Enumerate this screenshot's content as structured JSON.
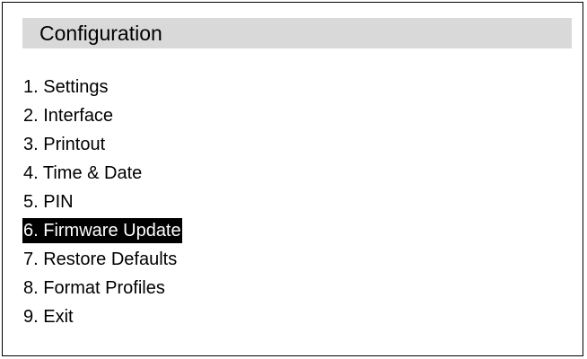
{
  "window": {
    "title": "Configuration"
  },
  "menu": {
    "selected_index": 5,
    "items": [
      {
        "label": "1. Settings"
      },
      {
        "label": "2. Interface"
      },
      {
        "label": "3. Printout"
      },
      {
        "label": "4. Time & Date"
      },
      {
        "label": "5. PIN"
      },
      {
        "label": "6. Firmware Update"
      },
      {
        "label": "7. Restore Defaults"
      },
      {
        "label": "8. Format Profiles"
      },
      {
        "label": "9. Exit"
      }
    ]
  },
  "colors": {
    "title_background": "#d9d9d9",
    "selection_background": "#000000",
    "selection_text": "#ffffff",
    "text": "#000000"
  }
}
